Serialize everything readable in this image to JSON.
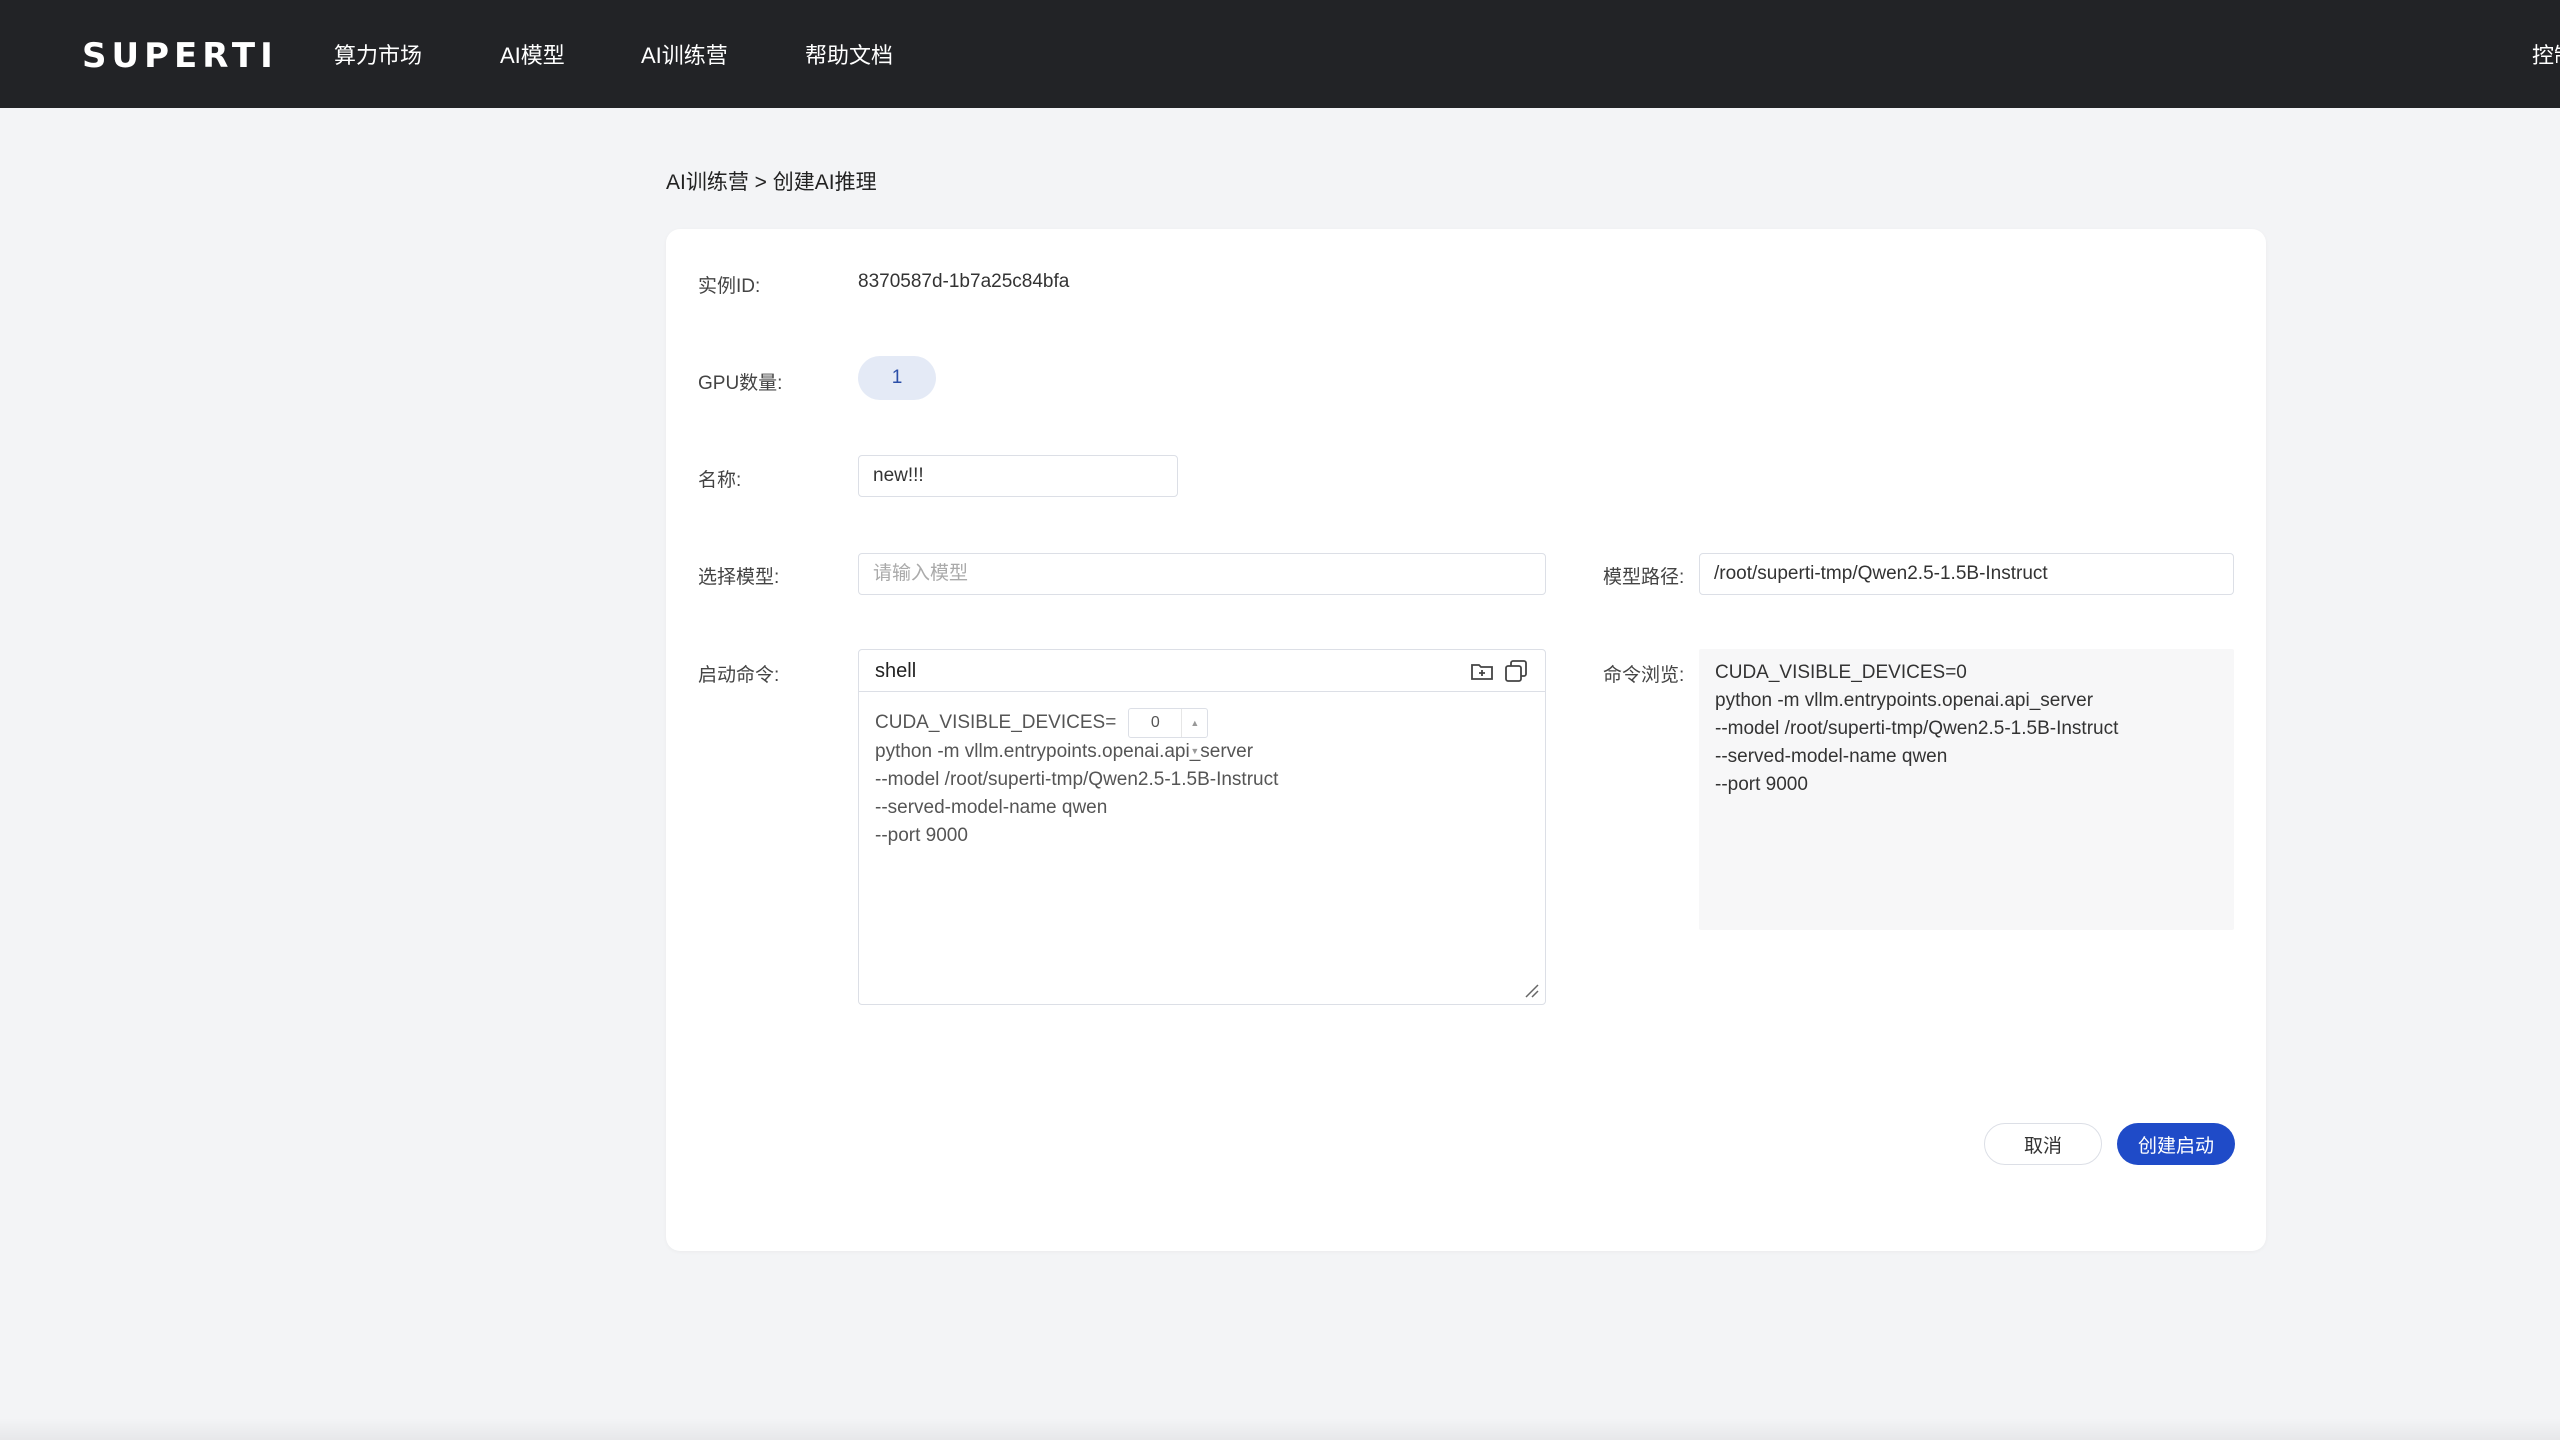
{
  "header": {
    "logo": "SUPERTI",
    "nav": [
      "算力市场",
      "AI模型",
      "AI训练营",
      "帮助文档"
    ],
    "right": "控制"
  },
  "breadcrumb": "AI训练营 > 创建AI推理",
  "form": {
    "instance_id_label": "实例ID:",
    "instance_id_value": "8370587d-1b7a25c84bfa",
    "gpu_label": "GPU数量:",
    "gpu_value": "1",
    "name_label": "名称:",
    "name_value": "new!!!",
    "model_label": "选择模型:",
    "model_placeholder": "请输入模型",
    "model_path_label": "模型路径:",
    "model_path_value": "/root/superti-tmp/Qwen2.5-1.5B-Instruct",
    "command_label": "启动命令:",
    "command_preview_label": "命令浏览:"
  },
  "editor": {
    "language": "shell",
    "cuda_prefix": "CUDA_VISIBLE_DEVICES=",
    "cuda_value": "0",
    "lines": [
      "python -m vllm.entrypoints.openai.api_server",
      "--model /root/superti-tmp/Qwen2.5-1.5B-Instruct",
      "--served-model-name qwen",
      "--port 9000"
    ]
  },
  "preview": {
    "lines": [
      "CUDA_VISIBLE_DEVICES=0",
      "python -m vllm.entrypoints.openai.api_server",
      "--model /root/superti-tmp/Qwen2.5-1.5B-Instruct",
      "--served-model-name qwen",
      "--port 9000"
    ]
  },
  "actions": {
    "cancel": "取消",
    "submit": "创建启动"
  },
  "colors": {
    "topbar": "#222326",
    "primary": "#1f4bc8",
    "pill_bg": "#e4eaf6"
  }
}
